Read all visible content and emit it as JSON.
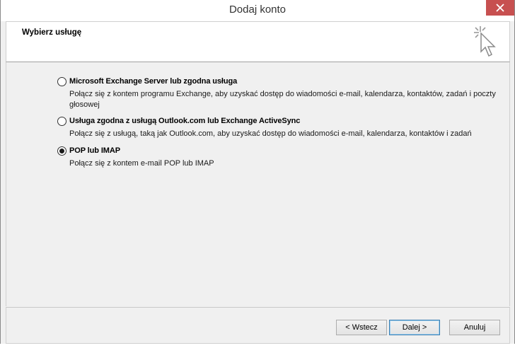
{
  "window": {
    "title": "Dodaj konto"
  },
  "header": {
    "title": "Wybierz usługę",
    "icon": "cursor-sparkle-icon"
  },
  "options": [
    {
      "label": "Microsoft Exchange Server lub zgodna usługa",
      "description": "Połącz się z kontem programu Exchange, aby uzyskać dostęp do wiadomości e-mail, kalendarza, kontaktów, zadań i poczty głosowej",
      "selected": false
    },
    {
      "label": "Usługa zgodna z usługą Outlook.com lub Exchange ActiveSync",
      "description": "Połącz się z usługą, taką jak Outlook.com, aby uzyskać dostęp do wiadomości e-mail, kalendarza, kontaktów i zadań",
      "selected": false
    },
    {
      "label": "POP lub IMAP",
      "description": "Połącz się z kontem e-mail POP lub IMAP",
      "selected": true
    }
  ],
  "footer": {
    "back_label": "< Wstecz",
    "next_label": "Dalej >",
    "cancel_label": "Anuluj"
  },
  "colors": {
    "close_button": "#c75050",
    "default_button_border": "#3c7fb1"
  }
}
